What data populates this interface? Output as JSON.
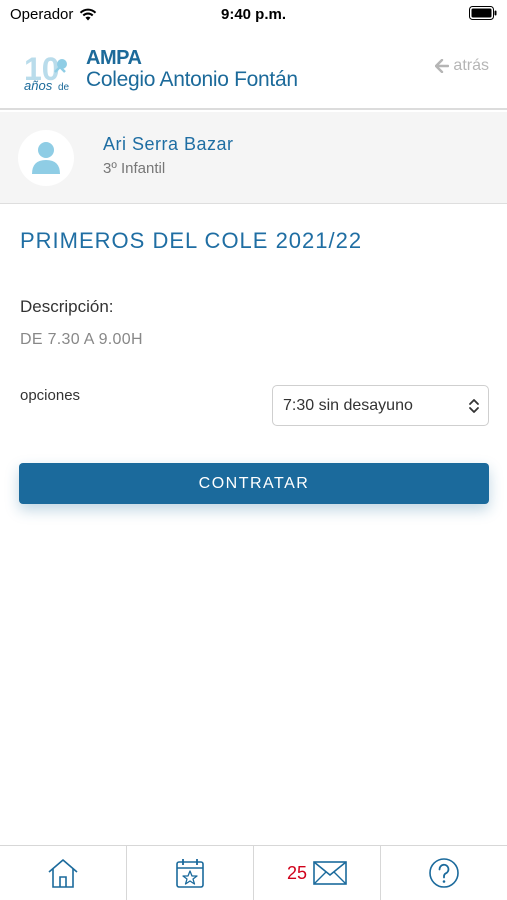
{
  "status_bar": {
    "carrier": "Operador",
    "time": "9:40 p.m."
  },
  "header": {
    "logo": {
      "badge_number": "10",
      "badge_text": "años de",
      "ampa": "AMPA",
      "school": "Colegio Antonio Fontán"
    },
    "back_label": "atrás"
  },
  "student": {
    "name": "Ari Serra Bazar",
    "course": "3º Infantil"
  },
  "activity": {
    "title": "PRIMEROS DEL COLE 2021/22",
    "description_label": "Descripción:",
    "description_value": "DE 7.30 A 9.00H",
    "options_label": "opciones",
    "options_selected": "7:30 sin desayuno",
    "contract_button": "CONTRATAR"
  },
  "tab_bar": {
    "tabs": [
      {
        "icon": "home-icon"
      },
      {
        "icon": "calendar-star-icon"
      },
      {
        "icon": "mail-icon",
        "badge": "25"
      },
      {
        "icon": "help-icon"
      }
    ]
  },
  "colors": {
    "primary": "#1b6a9c",
    "badge_red": "#d0021b",
    "avatar": "#8fcde5"
  }
}
